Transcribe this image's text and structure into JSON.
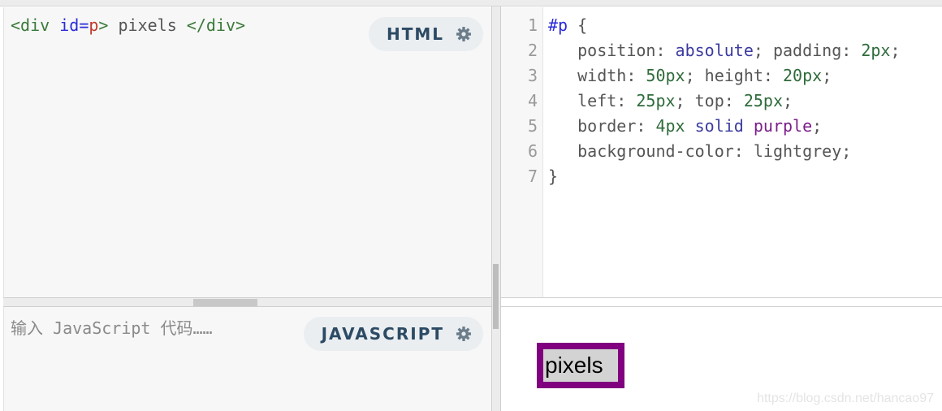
{
  "html_editor": {
    "code_tokens": {
      "open_tag": "<div",
      "attr": "id",
      "eq": "=",
      "value": "p",
      "close_bracket": ">",
      "text": " pixels ",
      "end_tag": "</div>"
    },
    "badge_label": "HTML",
    "badge_icon": "gear-icon"
  },
  "css_editor": {
    "line_numbers": [
      "1",
      "2",
      "3",
      "4",
      "5",
      "6",
      "7"
    ],
    "lines": [
      [
        {
          "t": "#p",
          "c": "sel"
        },
        {
          "t": " {",
          "c": ""
        }
      ],
      [
        {
          "t": "   position: ",
          "c": ""
        },
        {
          "t": "absolute",
          "c": "kw"
        },
        {
          "t": "; padding: ",
          "c": ""
        },
        {
          "t": "2px",
          "c": "num"
        },
        {
          "t": ";",
          "c": ""
        }
      ],
      [
        {
          "t": "   width: ",
          "c": ""
        },
        {
          "t": "50px",
          "c": "num"
        },
        {
          "t": "; height: ",
          "c": ""
        },
        {
          "t": "20px",
          "c": "num"
        },
        {
          "t": ";",
          "c": ""
        }
      ],
      [
        {
          "t": "   left: ",
          "c": ""
        },
        {
          "t": "25px",
          "c": "num"
        },
        {
          "t": "; top: ",
          "c": ""
        },
        {
          "t": "25px",
          "c": "num"
        },
        {
          "t": ";",
          "c": ""
        }
      ],
      [
        {
          "t": "   border: ",
          "c": ""
        },
        {
          "t": "4px",
          "c": "num"
        },
        {
          "t": " ",
          "c": ""
        },
        {
          "t": "solid",
          "c": "kw"
        },
        {
          "t": " ",
          "c": ""
        },
        {
          "t": "purple",
          "c": "purple"
        },
        {
          "t": ";",
          "c": ""
        }
      ],
      [
        {
          "t": "   background-color: lightgrey;",
          "c": ""
        }
      ],
      [
        {
          "t": "}",
          "c": ""
        }
      ]
    ]
  },
  "js_editor": {
    "placeholder": "输入 JavaScript 代码……",
    "badge_label": "JAVASCRIPT",
    "badge_icon": "gear-icon"
  },
  "result": {
    "text": "pixels",
    "border_color": "#800080",
    "background_color": "#d3d3d3"
  },
  "watermark": "https://blog.csdn.net/hancao97"
}
